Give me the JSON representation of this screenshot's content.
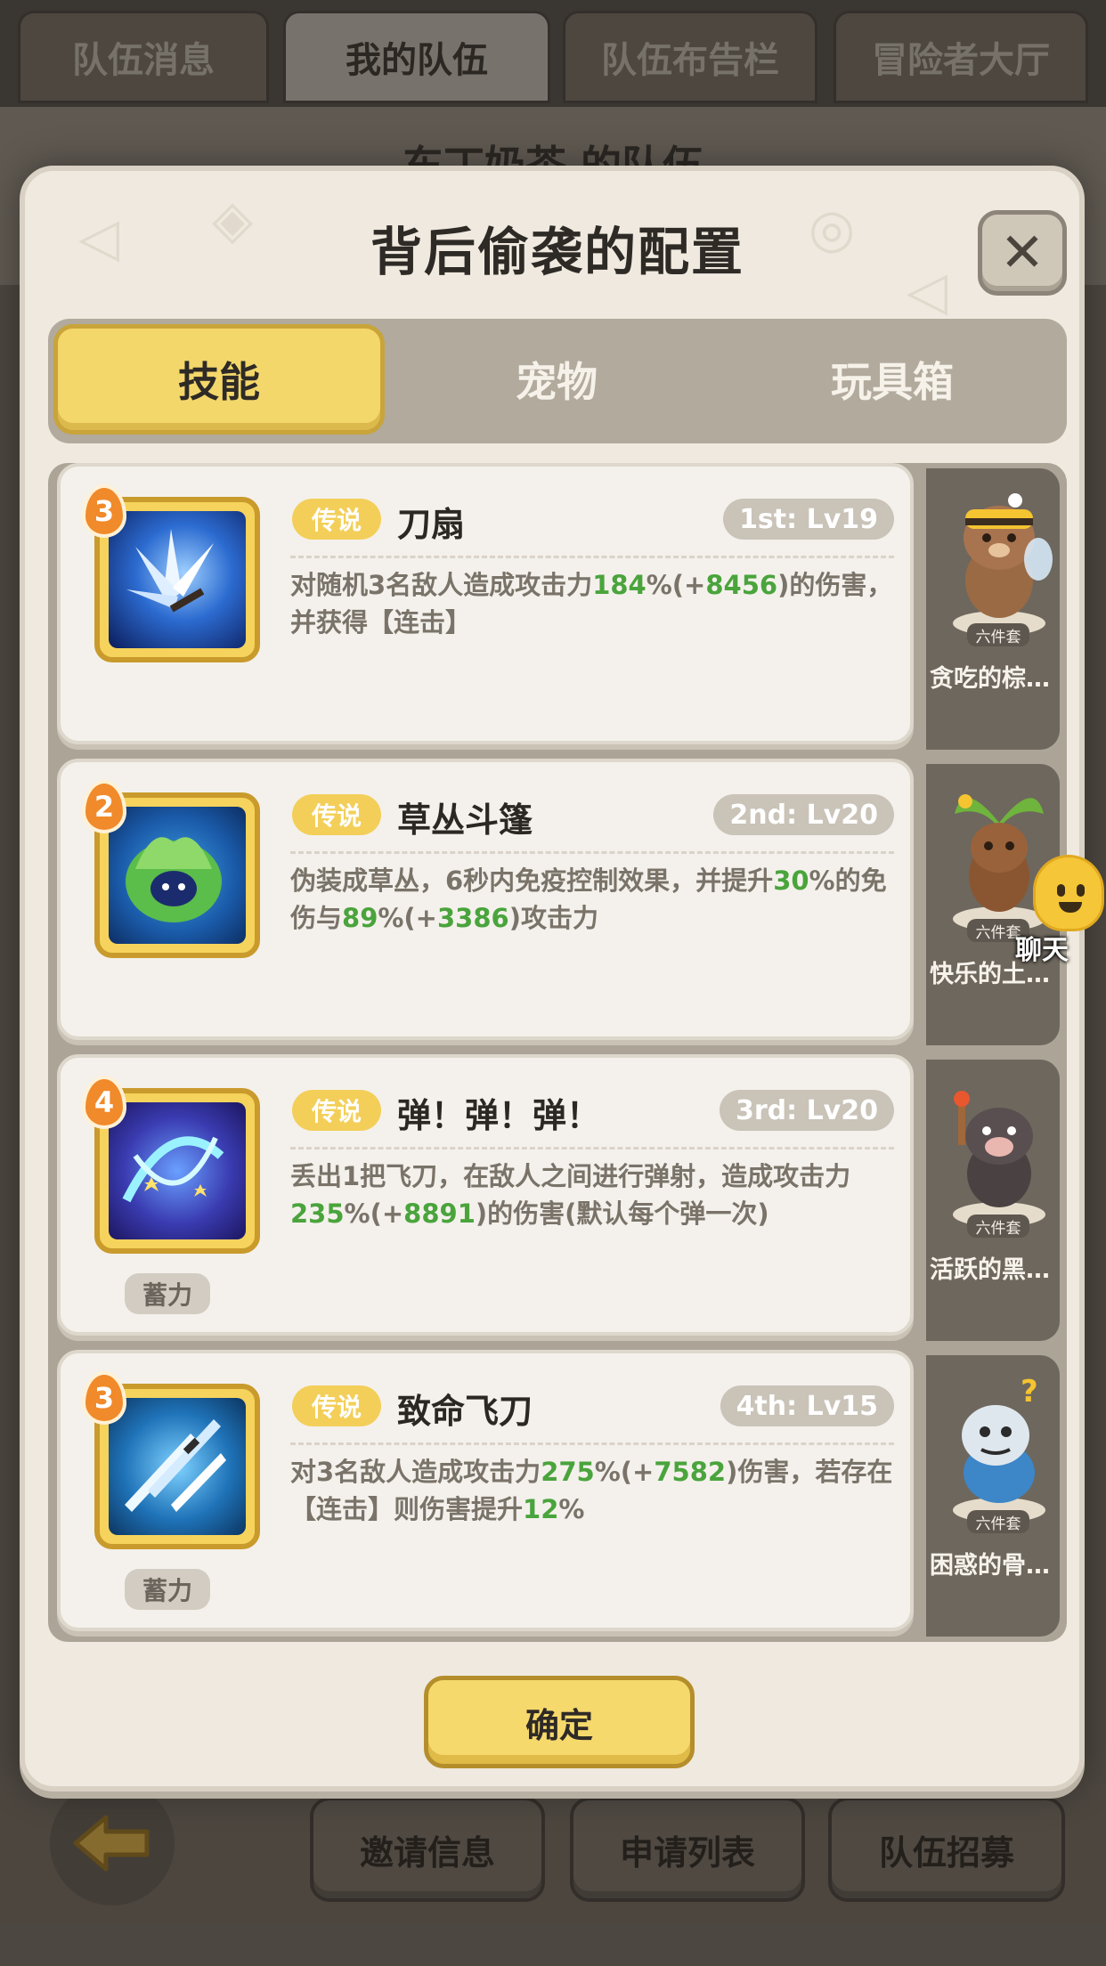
{
  "top_tabs": [
    "队伍消息",
    "我的队伍",
    "队伍布告栏",
    "冒险者大厅"
  ],
  "background_title": "东丁奶茶 的队伍",
  "modal": {
    "title": "背后偷袭的配置",
    "close_icon": "close-x-icon",
    "tabs": [
      "技能",
      "宠物",
      "玩具箱"
    ],
    "active_tab": "技能",
    "confirm_label": "确定"
  },
  "skills": [
    {
      "level": "3",
      "rarity": "传说",
      "name": "刀扇",
      "slot": "1st: Lv19",
      "desc_parts": [
        [
          "对随机3名敌人造成攻击力",
          ""
        ],
        [
          "184",
          "g"
        ],
        [
          "%(+",
          ""
        ],
        [
          "8456",
          "g"
        ],
        [
          ")的伤害，并获得【连击】",
          ""
        ]
      ],
      "charge": ""
    },
    {
      "level": "2",
      "rarity": "传说",
      "name": "草丛斗篷",
      "slot": "2nd: Lv20",
      "desc_parts": [
        [
          "伪装成草丛，6秒内免疫控制效果，并提升",
          ""
        ],
        [
          "30",
          "g"
        ],
        [
          "%的免伤与",
          ""
        ],
        [
          "89",
          "g"
        ],
        [
          "%(+",
          ""
        ],
        [
          "3386",
          "g"
        ],
        [
          ")攻击力",
          ""
        ]
      ],
      "charge": ""
    },
    {
      "level": "4",
      "rarity": "传说",
      "name": "弹！弹！弹！",
      "slot": "3rd: Lv20",
      "desc_parts": [
        [
          "丢出1把飞刀，在敌人之间进行弹射，造成攻击力",
          ""
        ],
        [
          "235",
          "g"
        ],
        [
          "%(+",
          ""
        ],
        [
          "8891",
          "g"
        ],
        [
          ")的伤害(默认每个弹一次)",
          ""
        ]
      ],
      "charge": "蓄力"
    },
    {
      "level": "3",
      "rarity": "传说",
      "name": "致命飞刀",
      "slot": "4th: Lv15",
      "desc_parts": [
        [
          "对3名敌人造成攻击力",
          ""
        ],
        [
          "275",
          "g"
        ],
        [
          "%(+",
          ""
        ],
        [
          "7582",
          "g"
        ],
        [
          ")伤害，若存在【连击】则伤害提升",
          ""
        ],
        [
          "12",
          "g"
        ],
        [
          "%",
          ""
        ]
      ],
      "charge": "蓄力"
    }
  ],
  "pets": [
    {
      "name": "贪吃的棕…",
      "tag": "六件套",
      "icon": "bee-bear-pet-icon"
    },
    {
      "name": "快乐的土…",
      "tag": "六件套",
      "icon": "plant-bear-pet-icon"
    },
    {
      "name": "活跃的黑…",
      "tag": "六件套",
      "icon": "boar-pet-icon"
    },
    {
      "name": "困惑的骨…",
      "tag": "六件套",
      "icon": "dino-pet-icon"
    }
  ],
  "chat": {
    "label": "聊天",
    "icon": "chat-smiley-icon"
  },
  "bottom": {
    "back_icon": "back-arrow-icon",
    "buttons": [
      "邀请信息",
      "申请列表",
      "队伍招募"
    ]
  },
  "colors": {
    "accent_yellow": "#f3d76b",
    "value_green": "#4aa43c",
    "level_orange": "#f08a2a"
  }
}
